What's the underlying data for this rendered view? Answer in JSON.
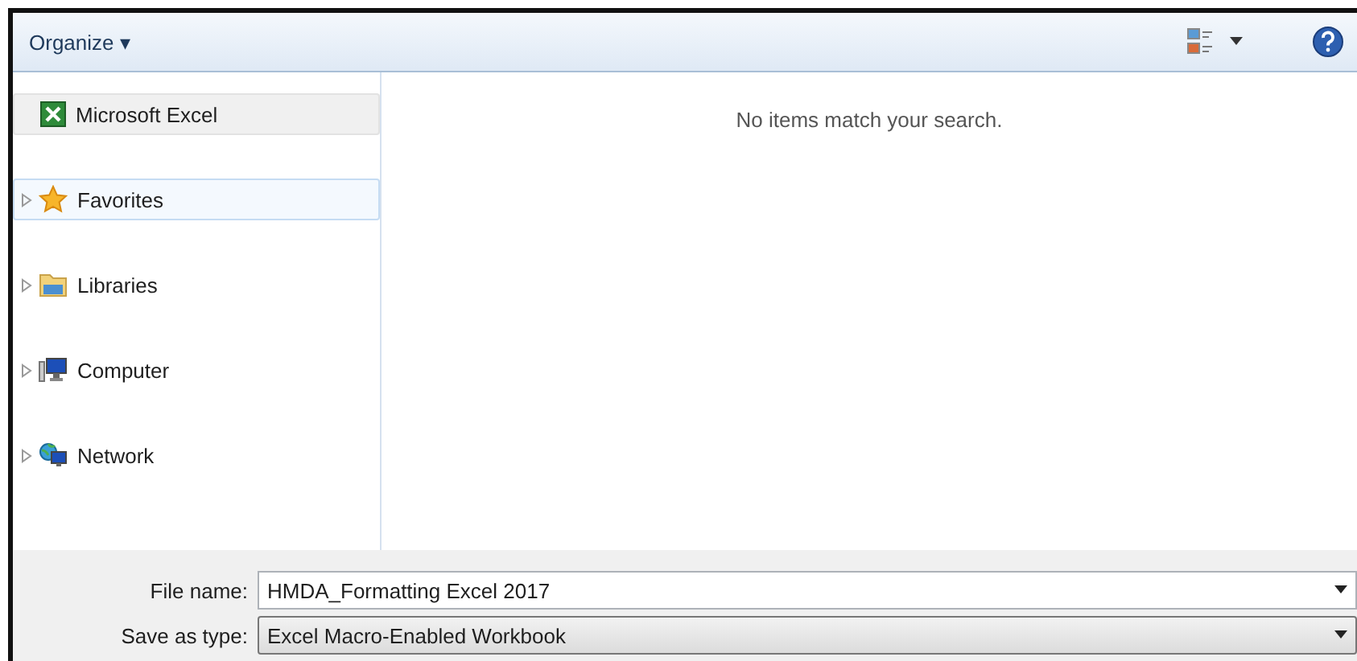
{
  "toolbar": {
    "organize": "Organize ▾"
  },
  "sidebar": {
    "items": [
      {
        "kind": "pinned",
        "label": "Microsoft Excel",
        "selected": false
      },
      {
        "kind": "tree",
        "label": "Favorites",
        "selected": true,
        "expanded": false
      },
      {
        "kind": "tree",
        "label": "Libraries",
        "selected": false,
        "expanded": false
      },
      {
        "kind": "tree",
        "label": "Computer",
        "selected": false,
        "expanded": false
      },
      {
        "kind": "tree",
        "label": "Network",
        "selected": false,
        "expanded": false
      }
    ]
  },
  "content": {
    "empty_message": "No items match your search."
  },
  "form": {
    "fields": [
      {
        "label": "File name:",
        "value": "HMDA_Formatting Excel 2017",
        "kind": "combo"
      },
      {
        "label": "Save as type:",
        "value": "Excel Macro-Enabled Workbook",
        "kind": "select"
      }
    ]
  }
}
